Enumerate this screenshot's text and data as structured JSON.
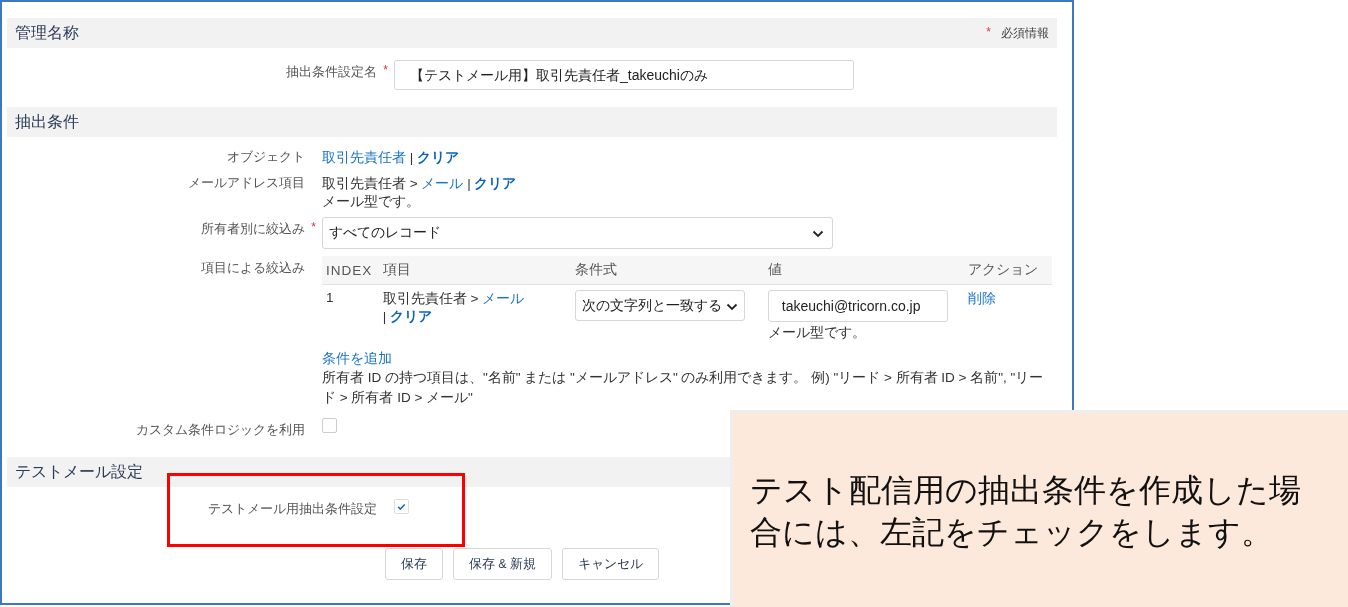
{
  "management": {
    "title": "管理名称",
    "required_mark": "*",
    "required_note": "必須情報",
    "name_field": {
      "label": "抽出条件設定名",
      "required": true,
      "value": "【テストメール用】取引先責任者_takeuchiのみ"
    }
  },
  "extraction": {
    "title": "抽出条件",
    "object": {
      "label": "オブジェクト",
      "value": "取引先責任者",
      "separator": "|",
      "clear": "クリア"
    },
    "email_field": {
      "label": "メールアドレス項目",
      "path": "取引先責任者 >",
      "link": "メール",
      "separator": "|",
      "clear": "クリア",
      "note": "メール型です。"
    },
    "owner_filter": {
      "label": "所有者別に絞込み",
      "required": true,
      "value": "すべてのレコード"
    },
    "item_filter": {
      "label": "項目による絞込み",
      "columns": [
        "INDEX",
        "項目",
        "条件式",
        "値",
        "アクション"
      ],
      "rows": [
        {
          "index": "1",
          "path": "取引先責任者 >",
          "link": "メール",
          "separator": "|",
          "clear": "クリア",
          "operator": "次の文字列と一致する",
          "value": "takeuchi@tricorn.co.jp",
          "note": "メール型です。",
          "action": "削除"
        }
      ],
      "add_link": "条件を追加",
      "help": "所有者 ID の持つ項目は、\"名前\" または \"メールアドレス\" のみ利用できます。 例) \"リード > 所有者 ID > 名前\", \"リード > 所有者 ID > メール\""
    },
    "custom_logic": {
      "label": "カスタム条件ロジックを利用",
      "checked": false
    }
  },
  "test_mail": {
    "title": "テストメール設定",
    "option": {
      "label": "テストメール用抽出条件設定",
      "checked": true
    }
  },
  "buttons": [
    "保存",
    "保存 & 新規",
    "キャンセル"
  ],
  "callout": {
    "text": "テスト配信用の抽出条件を作成した場合には、左記をチェックをします。"
  }
}
